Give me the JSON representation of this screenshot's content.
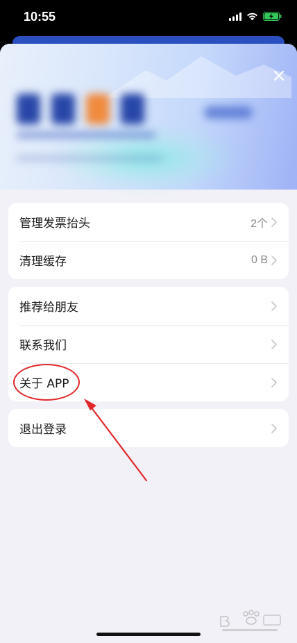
{
  "status_bar": {
    "time": "10:55",
    "battery": "charging"
  },
  "settings": {
    "group1": [
      {
        "label": "管理发票抬头",
        "value": "2个"
      },
      {
        "label": "清理缓存",
        "value": "0 B"
      }
    ],
    "group2": [
      {
        "label": "推荐给朋友",
        "value": ""
      },
      {
        "label": "联系我们",
        "value": ""
      },
      {
        "label": "关于 APP",
        "value": ""
      }
    ],
    "group3": [
      {
        "label": "退出登录",
        "value": ""
      }
    ]
  },
  "colors": {
    "annotation": "#e1262a",
    "sheet_bg": "#f2f1f8",
    "battery": "#34c759"
  },
  "icons": [
    "signal-icon",
    "wifi-icon",
    "battery-charging-icon",
    "close-icon",
    "chevron-right-icon"
  ]
}
